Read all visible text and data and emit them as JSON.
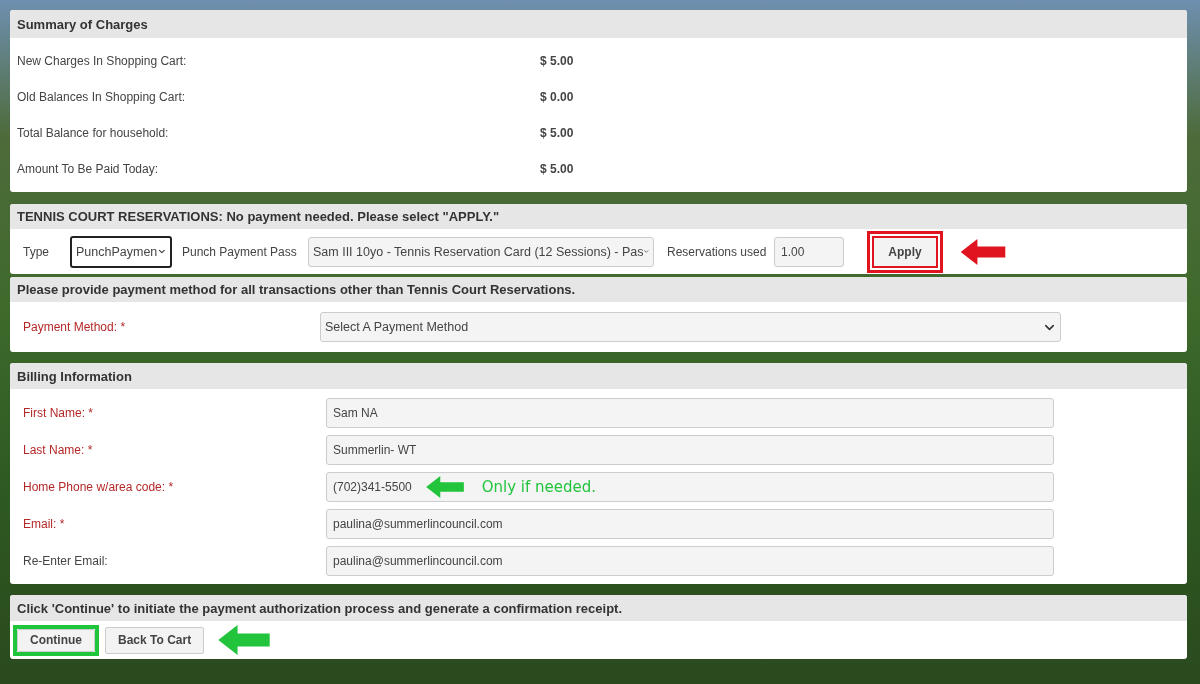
{
  "summary": {
    "title": "Summary of Charges",
    "rows": [
      {
        "label": "New Charges In Shopping Cart:",
        "value": "$ 5.00"
      },
      {
        "label": "Old Balances In Shopping Cart:",
        "value": "$ 0.00"
      },
      {
        "label": "Total Balance for household:",
        "value": "$ 5.00"
      },
      {
        "label": "Amount To Be Paid Today:",
        "value": "$ 5.00"
      }
    ]
  },
  "tennis": {
    "title": "TENNIS COURT RESERVATIONS: No payment needed. Please select \"APPLY.\"",
    "type_label": "Type",
    "type_value": "PunchPaymen",
    "type_focused": true,
    "pass_label": "Punch Payment Pass",
    "pass_value": "Sam III 10yo - Tennis Reservation Card (12 Sessions) - Pas",
    "used_label": "Reservations used",
    "used_value": "1.00",
    "apply": {
      "label": "Apply",
      "highlighted": true,
      "pointer_arrow": true
    }
  },
  "payment": {
    "title": "Please provide payment method for all transactions other than Tennis Court Reservations.",
    "label": "Payment Method: *",
    "required": true,
    "placeholder": "Select A Payment Method"
  },
  "billing": {
    "title": "Billing Information",
    "fields": [
      {
        "label": "First Name: *",
        "required": true,
        "value": "Sam NA"
      },
      {
        "label": "Last Name: *",
        "required": true,
        "value": "Summerlin- WT"
      },
      {
        "label": "Home Phone w/area code: *",
        "required": true,
        "value": "(702)341-5500",
        "note": "Only if needed."
      },
      {
        "label": "Email: *",
        "required": true,
        "value": "paulina@summerlincouncil.com"
      },
      {
        "label": "Re-Enter Email:",
        "required": false,
        "value": "paulina@summerlincouncil.com"
      }
    ]
  },
  "footer": {
    "title": "Click 'Continue' to initiate the payment authorization process and generate a confirmation receipt.",
    "pointer_arrow": true,
    "buttons": [
      {
        "label": "Continue",
        "highlighted": true
      },
      {
        "label": "Back To Cart",
        "highlighted": false
      }
    ]
  }
}
